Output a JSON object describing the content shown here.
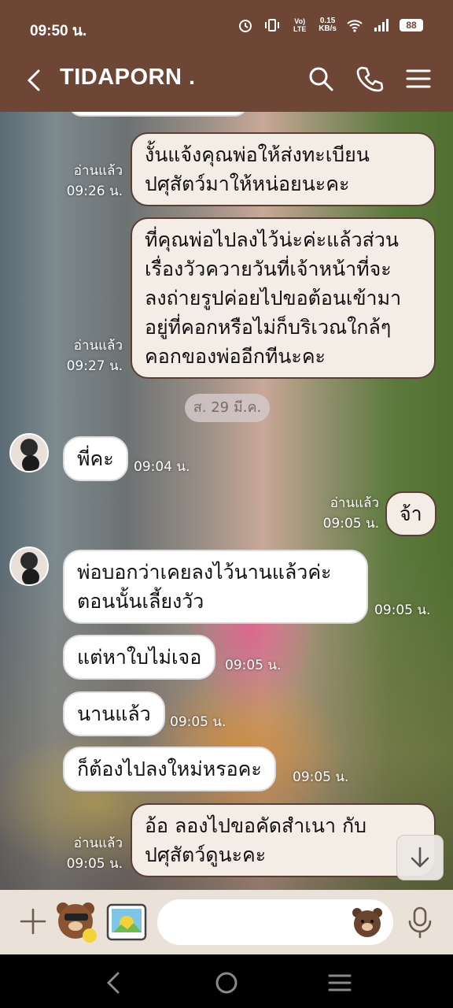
{
  "status_bar": {
    "time": "09:50 น.",
    "net_label": "Vo) LTE",
    "net_speed_value": "0.15",
    "net_speed_unit": "KB/s",
    "battery": "88"
  },
  "header": {
    "title": "TIDAPORN ."
  },
  "chat": {
    "date_divider": "ส. 29 มี.ค.",
    "read_label": "อ่านแล้ว",
    "messages": [
      {
        "text": "งั้นแจ้งคุณพ่อให้ส่งทะเบียน\nปศุสัตว์มาให้หน่อยนะคะ",
        "time": "09:26 น."
      },
      {
        "text": "ที่คุณพ่อไปลงไว้น่ะค่ะแล้วส่วน\nเรื่องวัวควายวันที่เจ้าหน้าที่จะ\nลงถ่ายรูปค่อยไปขอต้อนเข้ามา\nอยู่ที่คอกหรือไม่ก็บริเวณใกล้ๆ\nคอกของพ่ออีกทีนะคะ",
        "time": "09:27 น."
      },
      {
        "text": "พี่คะ",
        "time": "09:04 น."
      },
      {
        "text": "จ้า",
        "time": "09:05 น."
      },
      {
        "text": "พ่อบอกว่าเคยลงไว้นานแล้วค่ะ\nตอนนั้นเลี้ยงวัว",
        "time": "09:05 น."
      },
      {
        "text": "แต่หาใบไม่เจอ",
        "time": "09:05 น."
      },
      {
        "text": "นานแล้ว",
        "time": "09:05 น."
      },
      {
        "text": "ก็ต้องไปลงใหม่หรอคะ",
        "time": "09:05 น."
      },
      {
        "text": "อ้อ ลองไปขอคัดสำเนา กับ\nปศุสัตว์ดูนะคะ",
        "time": "09:05 น."
      }
    ]
  },
  "input": {
    "placeholder": ""
  },
  "colors": {
    "header_bg": "#6e4636",
    "bubble_out_bg": "#f3ede6",
    "bubble_border": "#5a3f34",
    "input_bar_bg": "#eae2d9"
  }
}
